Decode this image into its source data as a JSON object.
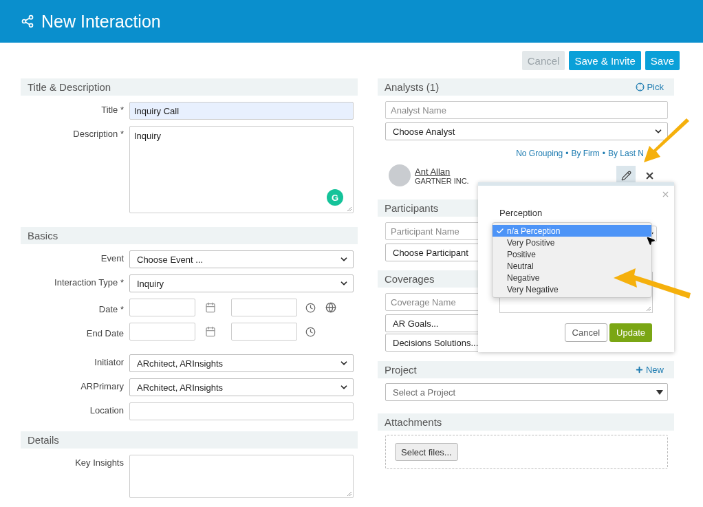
{
  "header": {
    "title": "New Interaction"
  },
  "actions": [
    {
      "label": "Cancel",
      "disabled": true,
      "kind": "secondary"
    },
    {
      "label": "Save & Invite",
      "disabled": false,
      "kind": "primary"
    },
    {
      "label": "Save",
      "disabled": false,
      "kind": "primary"
    }
  ],
  "left_sections": [
    {
      "title": "Title & Description",
      "fields": [
        {
          "kind": "text",
          "label": "Title *",
          "value": "Inquiry Call",
          "highlighted": true
        },
        {
          "kind": "textarea",
          "label": "Description *",
          "value": "Inquiry",
          "grammar_badge": "G"
        }
      ]
    },
    {
      "title": "Basics",
      "fields": [
        {
          "kind": "select",
          "label": "Event",
          "value": "Choose Event ..."
        },
        {
          "kind": "select",
          "label": "Interaction Type *",
          "value": "Inquiry"
        },
        {
          "kind": "datetime_zone",
          "label": "Date *"
        },
        {
          "kind": "datetime",
          "label": "End Date"
        },
        {
          "kind": "select",
          "label": "Initiator",
          "value": "ARchitect, ARInsights"
        },
        {
          "kind": "select",
          "label": "ARPrimary",
          "value": "ARchitect, ARInsights"
        },
        {
          "kind": "text",
          "label": "Location"
        }
      ]
    },
    {
      "title": "Details",
      "fields": [
        {
          "kind": "textarea",
          "label": "Key Insights",
          "short": true
        }
      ]
    }
  ],
  "analysts": {
    "title": "Analysts (1)",
    "action": "Pick",
    "search_placeholder": "Analyst Name",
    "choose": "Choose Analyst",
    "grouping": [
      "No Grouping",
      "•",
      "By Firm",
      "•",
      "By Last N"
    ],
    "items": [
      {
        "name": "Ant Allan",
        "firm": "GARTNER INC."
      }
    ]
  },
  "participants": {
    "title": "Participants",
    "search_placeholder": "Participant Name",
    "choose": "Choose Participant"
  },
  "coverages": {
    "title": "Coverages",
    "search_placeholder": "Coverage Name",
    "items": [
      "AR Goals...",
      "Decisions Solutions..."
    ]
  },
  "project": {
    "title": "Project",
    "action": "New",
    "placeholder": "Select a Project"
  },
  "attachments": {
    "title": "Attachments",
    "button": "Select files..."
  },
  "popup": {
    "label": "Perception",
    "options": [
      {
        "label": "n/a Perception",
        "selected": true
      },
      {
        "label": "Very Positive",
        "selected": false
      },
      {
        "label": "Positive",
        "selected": false
      },
      {
        "label": "Neutral",
        "selected": false
      },
      {
        "label": "Negative",
        "selected": false
      },
      {
        "label": "Very Negative",
        "selected": false
      }
    ],
    "cancel": "Cancel",
    "submit": "Update"
  }
}
